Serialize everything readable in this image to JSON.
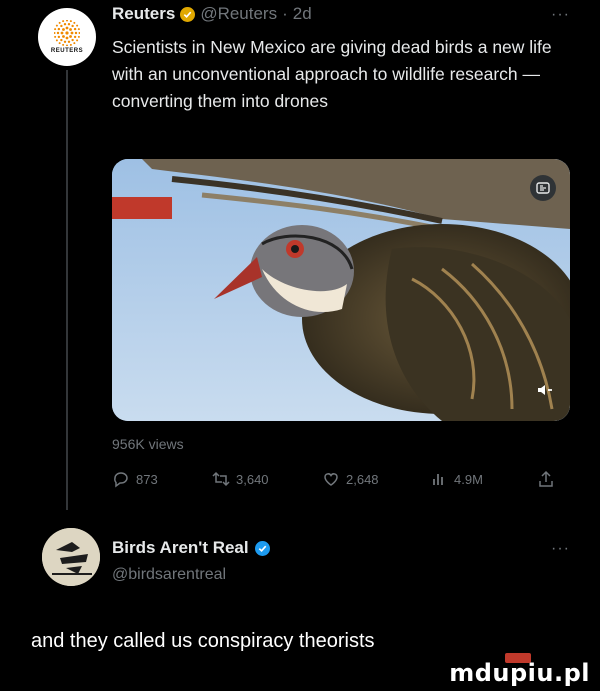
{
  "post": {
    "author_name": "Reuters",
    "handle": "@Reuters",
    "separator": "·",
    "time": "2d",
    "avatar_word": "REUTERS",
    "more": "···",
    "text": "Scientists in New Mexico are giving dead birds a new life with an unconventional approach to wildlife research — converting them into drones",
    "views": "956K views",
    "actions": {
      "replies": "873",
      "reposts": "3,640",
      "likes": "2,648",
      "analytics": "4.9M"
    }
  },
  "reply": {
    "author_name": "Birds Aren't Real",
    "handle": "@birdsarentreal",
    "more": "···"
  },
  "caption": "and they called us conspiracy theorists",
  "watermark": "mdupiu.pl",
  "colors": {
    "background": "#000000",
    "text": "#e7e9ea",
    "muted": "#71767b",
    "verified_gold": "#e0a800",
    "verified_blue": "#1d9bf0"
  },
  "icons": [
    "verified-gold-icon",
    "verified-blue-icon",
    "reply-icon",
    "repost-icon",
    "like-icon",
    "analytics-icon",
    "share-icon",
    "gif-icon",
    "volume-icon"
  ]
}
